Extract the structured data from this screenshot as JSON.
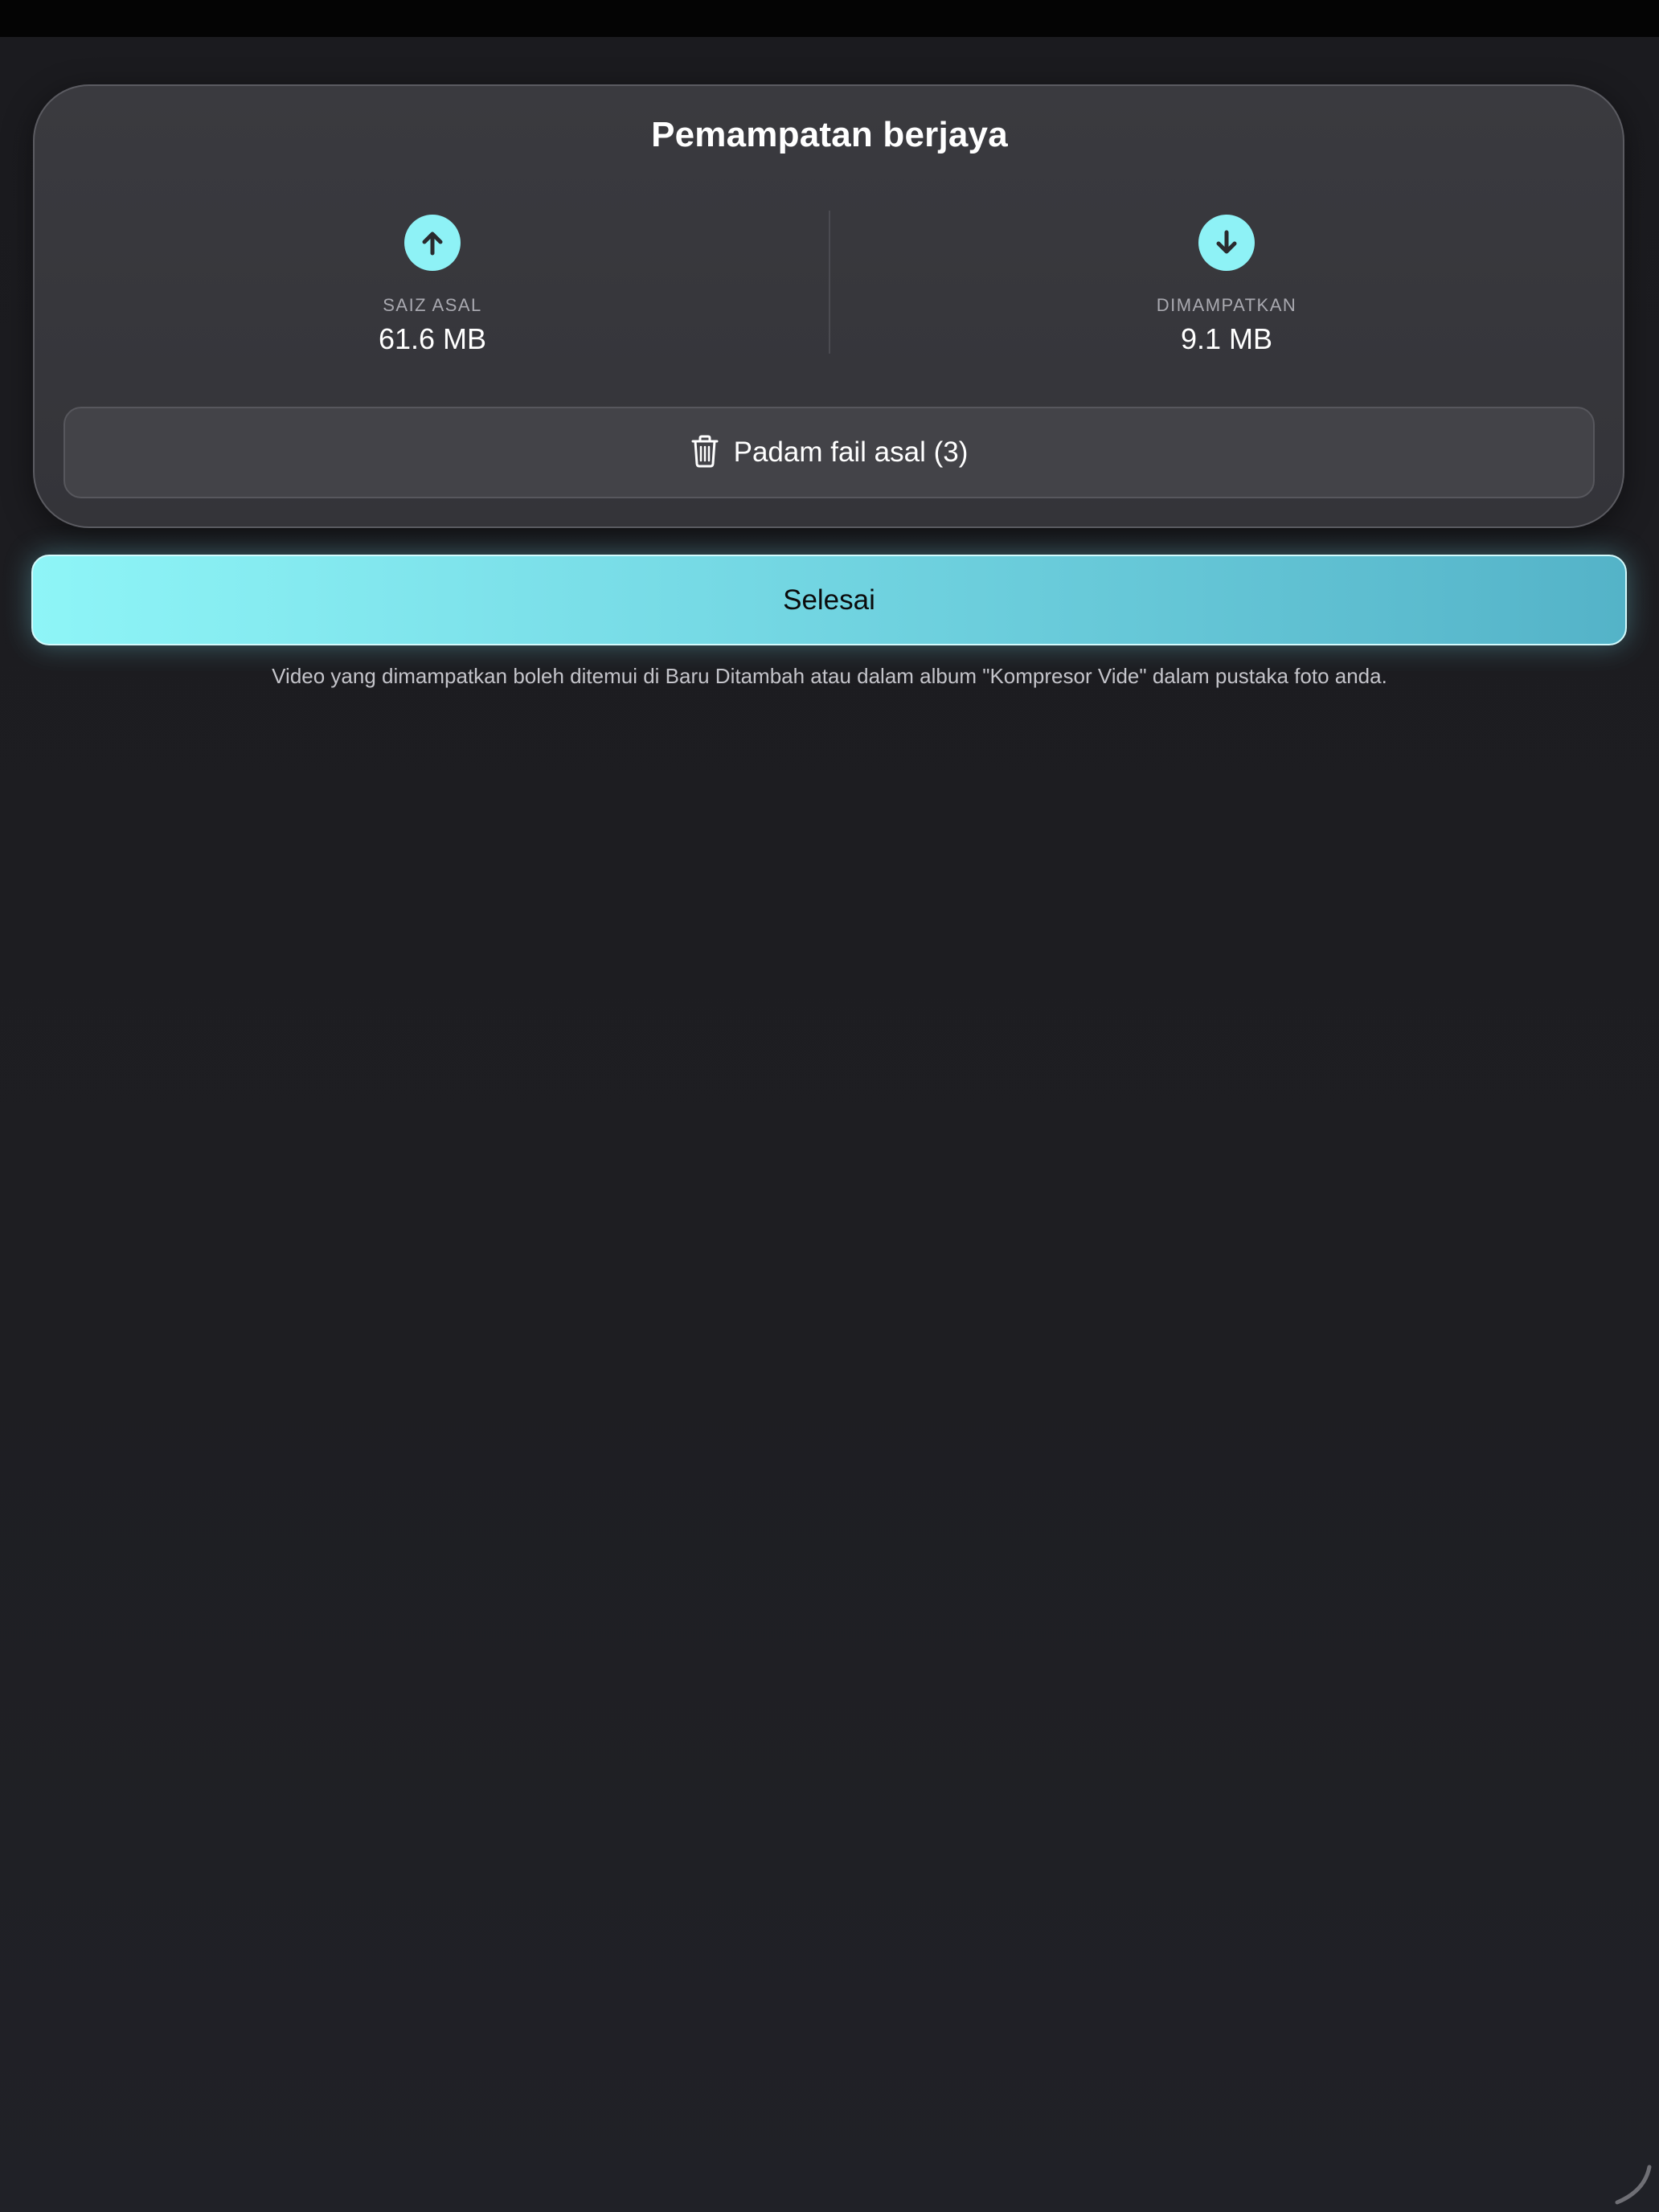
{
  "summary": {
    "title": "Pemampatan berjaya",
    "original": {
      "label": "SAIZ ASAL",
      "value": "61.6 MB",
      "icon": "arrow-up-icon"
    },
    "compressed": {
      "label": "DIMAMPATKAN",
      "value": "9.1 MB",
      "icon": "arrow-down-icon"
    },
    "delete_button": {
      "label": "Padam fail asal (3)",
      "icon": "trash-icon"
    }
  },
  "done_button": {
    "label": "Selesai"
  },
  "footnote": "Video yang dimampatkan boleh ditemui di Baru Ditambah atau dalam album \"Kompresor Vide\" dalam pustaka foto anda.",
  "colors": {
    "accent": "#8ef2f6",
    "background": "#1e1e22",
    "card": "#38383d"
  }
}
